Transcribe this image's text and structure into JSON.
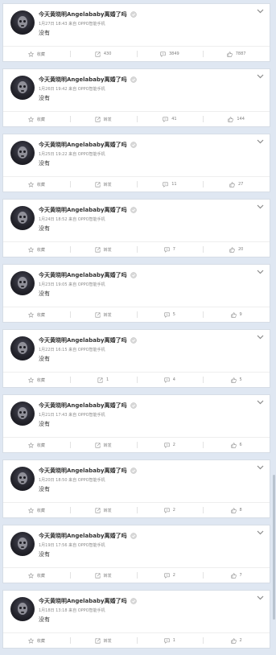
{
  "feed": {
    "posts": [
      {
        "author": "今天黄晓明Angelababy离婚了吗",
        "meta": "1月27日 18:43 来自 OPPO智能手机",
        "text": "没有",
        "actions": {
          "favorite": "收藏",
          "repost": "430",
          "comment": "3849",
          "like": "7887"
        }
      },
      {
        "author": "今天黄晓明Angelababy离婚了吗",
        "meta": "1月26日 19:42 来自 OPPO智能手机",
        "text": "没有",
        "actions": {
          "favorite": "收藏",
          "repost": "转发",
          "comment": "41",
          "like": "144"
        }
      },
      {
        "author": "今天黄晓明Angelababy离婚了吗",
        "meta": "1月25日 19:22 来自 OPPO智能手机",
        "text": "没有",
        "actions": {
          "favorite": "收藏",
          "repost": "转发",
          "comment": "11",
          "like": "27"
        }
      },
      {
        "author": "今天黄晓明Angelababy离婚了吗",
        "meta": "1月24日 18:52 来自 OPPO智能手机",
        "text": "没有",
        "actions": {
          "favorite": "收藏",
          "repost": "转发",
          "comment": "7",
          "like": "20"
        }
      },
      {
        "author": "今天黄晓明Angelababy离婚了吗",
        "meta": "1月23日 19:05 来自 OPPO智能手机",
        "text": "没有",
        "actions": {
          "favorite": "收藏",
          "repost": "转发",
          "comment": "5",
          "like": "9"
        }
      },
      {
        "author": "今天黄晓明Angelababy离婚了吗",
        "meta": "1月22日 16:15 来自 OPPO智能手机",
        "text": "没有",
        "actions": {
          "favorite": "收藏",
          "repost": "1",
          "comment": "4",
          "like": "5"
        }
      },
      {
        "author": "今天黄晓明Angelababy离婚了吗",
        "meta": "1月21日 17:43 来自 OPPO智能手机",
        "text": "没有",
        "actions": {
          "favorite": "收藏",
          "repost": "转发",
          "comment": "2",
          "like": "6"
        }
      },
      {
        "author": "今天黄晓明Angelababy离婚了吗",
        "meta": "1月20日 18:50 来自 OPPO智能手机",
        "text": "没有",
        "actions": {
          "favorite": "收藏",
          "repost": "转发",
          "comment": "2",
          "like": "8"
        }
      },
      {
        "author": "今天黄晓明Angelababy离婚了吗",
        "meta": "1月19日 17:56 来自 OPPO智能手机",
        "text": "没有",
        "actions": {
          "favorite": "收藏",
          "repost": "转发",
          "comment": "2",
          "like": "7"
        }
      },
      {
        "author": "今天黄晓明Angelababy离婚了吗",
        "meta": "1月18日 13:18 来自 OPPO智能手机",
        "text": "没有",
        "actions": {
          "favorite": "收藏",
          "repost": "转发",
          "comment": "1",
          "like": "2"
        }
      }
    ]
  },
  "icons": {
    "verified": "verified-badge-icon",
    "menu": "chevron-down-icon",
    "favorite": "star-icon",
    "repost": "repost-icon",
    "comment": "comment-icon",
    "like": "thumbs-up-icon"
  },
  "colors": {
    "page_background": "#dfe7f2",
    "card_background": "#ffffff",
    "name_text": "#333333",
    "meta_text": "#8a8a8a",
    "action_text": "#808080"
  }
}
